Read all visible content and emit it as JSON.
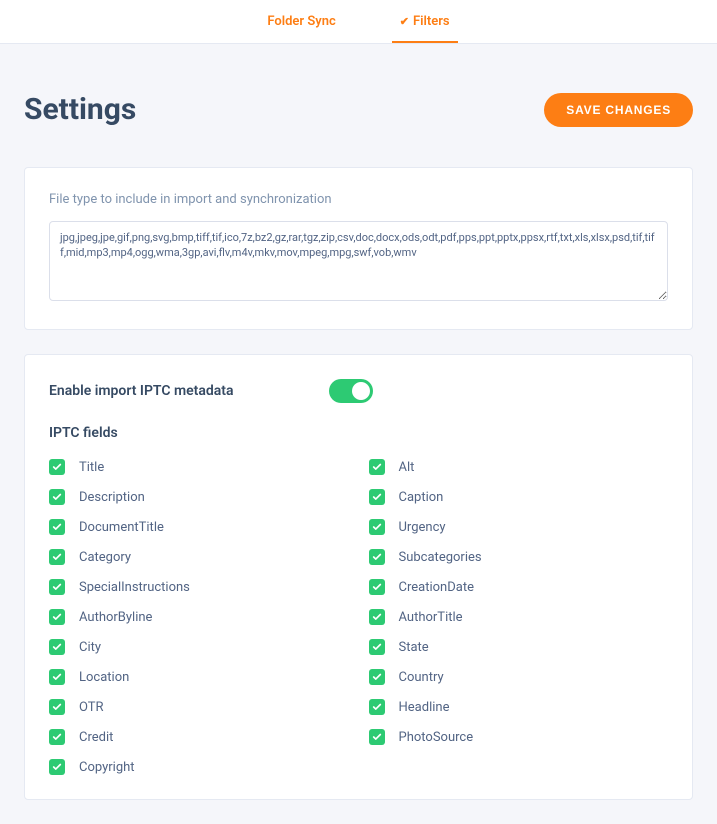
{
  "tabs": {
    "folder_sync": "Folder Sync",
    "filters": "Filters"
  },
  "header": {
    "title": "Settings",
    "save_button": "SAVE CHANGES"
  },
  "filetype_block": {
    "label": "File type to include in import and synchronization",
    "value": "jpg,jpeg,jpe,gif,png,svg,bmp,tiff,tif,ico,7z,bz2,gz,rar,tgz,zip,csv,doc,docx,ods,odt,pdf,pps,ppt,pptx,ppsx,rtf,txt,xls,xlsx,psd,tif,tiff,mid,mp3,mp4,ogg,wma,3gp,avi,flv,m4v,mkv,mov,mpeg,mpg,swf,vob,wmv"
  },
  "iptc": {
    "toggle_label": "Enable import IPTC metadata",
    "toggle_on": true,
    "fields_heading": "IPTC fields",
    "col1": [
      {
        "name": "Title",
        "checked": true
      },
      {
        "name": "Description",
        "checked": true
      },
      {
        "name": "DocumentTitle",
        "checked": true
      },
      {
        "name": "Category",
        "checked": true
      },
      {
        "name": "SpecialInstructions",
        "checked": true
      },
      {
        "name": "AuthorByline",
        "checked": true
      },
      {
        "name": "City",
        "checked": true
      },
      {
        "name": "Location",
        "checked": true
      },
      {
        "name": "OTR",
        "checked": true
      },
      {
        "name": "Credit",
        "checked": true
      },
      {
        "name": "Copyright",
        "checked": true
      }
    ],
    "col2": [
      {
        "name": "Alt",
        "checked": true
      },
      {
        "name": "Caption",
        "checked": true
      },
      {
        "name": "Urgency",
        "checked": true
      },
      {
        "name": "Subcategories",
        "checked": true
      },
      {
        "name": "CreationDate",
        "checked": true
      },
      {
        "name": "AuthorTitle",
        "checked": true
      },
      {
        "name": "State",
        "checked": true
      },
      {
        "name": "Country",
        "checked": true
      },
      {
        "name": "Headline",
        "checked": true
      },
      {
        "name": "PhotoSource",
        "checked": true
      }
    ]
  }
}
